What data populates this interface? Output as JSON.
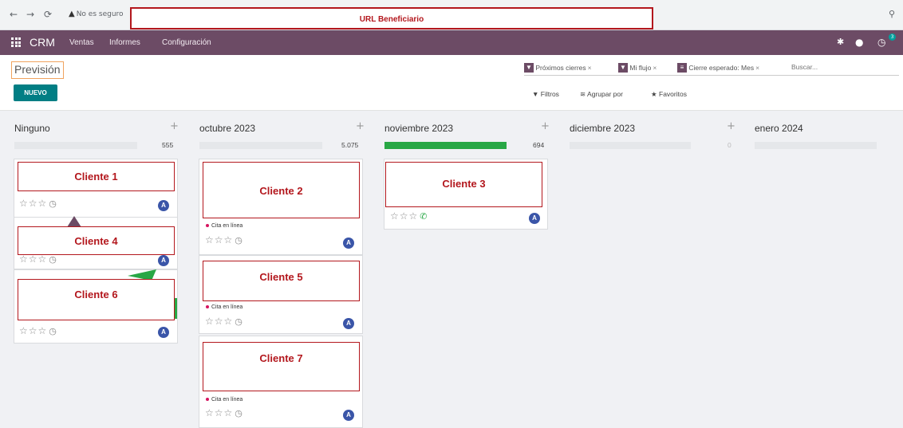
{
  "browser": {
    "security_text": "No es seguro",
    "url_label": "URL Beneficiario"
  },
  "navbar": {
    "app_name": "CRM",
    "menu": [
      "Ventas",
      "Informes",
      "Configuración"
    ],
    "activity_count": "3"
  },
  "control": {
    "title": "Previsión",
    "new_button": "NUEVO",
    "facets": [
      "Próximos cierres",
      "Mi flujo",
      "Cierre esperado: Mes"
    ],
    "search_placeholder": "Buscar...",
    "filters_label": "Filtros",
    "group_by_label": "Agrupar por",
    "favorites_label": "Favoritos"
  },
  "columns": [
    {
      "title": "Ninguno",
      "total": "555",
      "progress": 0
    },
    {
      "title": "octubre 2023",
      "total": "5.075",
      "progress": 0
    },
    {
      "title": "noviembre 2023",
      "total": "694",
      "progress": 1.0
    },
    {
      "title": "diciembre 2023",
      "total": "0",
      "progress": 0
    },
    {
      "title": "enero 2024",
      "total": "",
      "progress": 0
    }
  ],
  "cards": {
    "c1": {
      "label": "Cliente 1"
    },
    "c2": {
      "label": "Cliente 2",
      "tag": "Cita en línea"
    },
    "c3": {
      "label": "Cliente 3"
    },
    "c4": {
      "label": "Cliente 4"
    },
    "c5": {
      "label": "Cliente 5",
      "tag": "Cita en línea"
    },
    "c6": {
      "label": "Cliente 6"
    },
    "c7": {
      "label": "Cliente 7",
      "tag": "Cita en línea"
    }
  },
  "avatar_letter": "A",
  "colors": {
    "navbar": "#6c4b65",
    "primary_button": "#017e84",
    "progress_green": "#28a745",
    "annotation_red": "#b3171d",
    "avatar_blue": "#3a55a8",
    "tag_dot": "#d6145f"
  }
}
